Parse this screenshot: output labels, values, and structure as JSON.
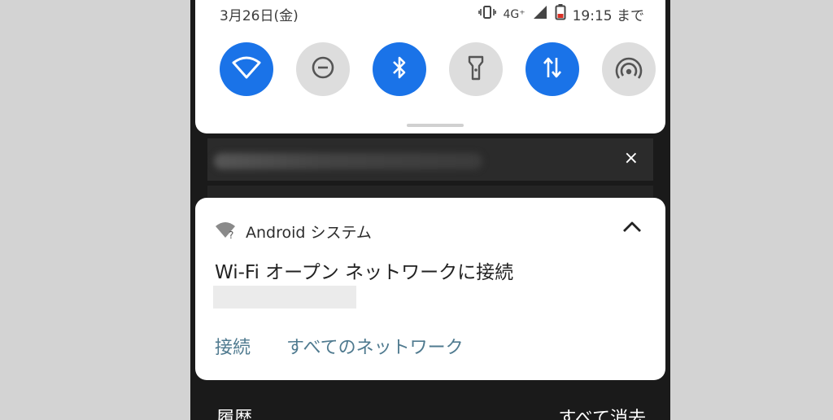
{
  "status": {
    "date": "3月26日(金)",
    "network": "4G⁺",
    "time_label": "19:15 まで",
    "icons": [
      "vibrate-icon",
      "signal-icon",
      "battery-icon"
    ]
  },
  "quick_settings": {
    "tiles": [
      {
        "name": "wifi",
        "state": "on",
        "icon": "wifi-icon"
      },
      {
        "name": "do-not-disturb",
        "state": "off",
        "icon": "do-not-disturb-icon"
      },
      {
        "name": "bluetooth",
        "state": "on",
        "icon": "bluetooth-icon"
      },
      {
        "name": "flashlight",
        "state": "off",
        "icon": "flashlight-icon"
      },
      {
        "name": "mobile-data",
        "state": "on",
        "icon": "mobile-data-icon"
      },
      {
        "name": "hotspot",
        "state": "off",
        "icon": "hotspot-icon"
      }
    ],
    "accent_color": "#1a73e8",
    "off_color": "#dddddd"
  },
  "background_notification": {
    "close_label": "×"
  },
  "notification": {
    "app_name": "Android システム",
    "app_icon": "wifi-question-icon",
    "title": "Wi-Fi オープン ネットワークに接続",
    "actions": {
      "connect": "接続",
      "all_networks": "すべてのネットワーク"
    },
    "action_color": "#4f7a8f"
  },
  "footer": {
    "history": "履歴",
    "clear_all": "すべて消去"
  }
}
